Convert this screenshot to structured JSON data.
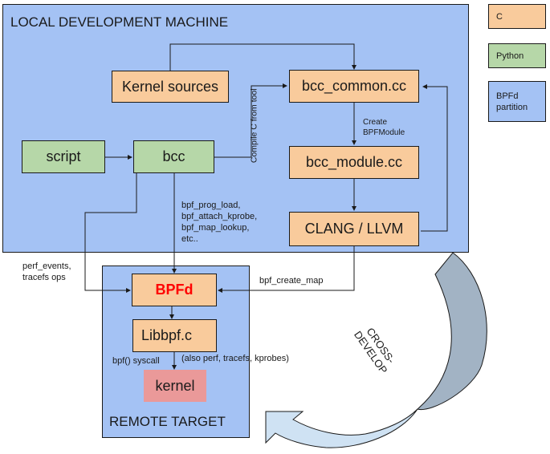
{
  "regions": {
    "local": {
      "title": "LOCAL DEVELOPMENT MACHINE"
    },
    "remote": {
      "title": "REMOTE TARGET"
    }
  },
  "nodes": {
    "kernel_sources": {
      "label": "Kernel sources",
      "language": "C"
    },
    "bcc_common": {
      "label": "bcc_common.cc",
      "language": "C"
    },
    "script": {
      "label": "script",
      "language": "Python"
    },
    "bcc": {
      "label": "bcc",
      "language": "Python"
    },
    "bcc_module": {
      "label": "bcc_module.cc",
      "language": "C"
    },
    "clang_llvm": {
      "label": "CLANG / LLVM",
      "language": "C"
    },
    "bpfd": {
      "label": "BPFd",
      "language": "C",
      "text_color": "#ff0000"
    },
    "libbpf": {
      "label": "Libbpf.c",
      "language": "C"
    },
    "kernel": {
      "label": "kernel"
    }
  },
  "edge_labels": {
    "compile_c": "Compile C from tool",
    "create_module_line1": "Create",
    "create_module_line2": "BPFModule",
    "bpf_calls_line1": "bpf_prog_load,",
    "bpf_calls_line2": "bpf_attach_kprobe,",
    "bpf_calls_line3": "bpf_map_lookup,",
    "bpf_calls_line4": "etc..",
    "perf_line1": "perf_events,",
    "perf_line2": "tracefs ops",
    "create_map": "bpf_create_map",
    "syscall": "bpf() syscall",
    "also": "(also perf, tracefs, kprobes)"
  },
  "cross_develop": {
    "line1": "CROSS-",
    "line2": "DEVELOP"
  },
  "legend": [
    {
      "label": "C",
      "color": "#f9cb9c"
    },
    {
      "label": "Python",
      "color": "#b6d7a8"
    },
    {
      "label": "BPFd partition",
      "line1": "BPFd",
      "line2": "partition",
      "color": "#a4c2f4"
    }
  ],
  "colors": {
    "c_box": "#f9cb9c",
    "python_box": "#b6d7a8",
    "partition": "#a4c2f4",
    "kernel_box": "#ea9999",
    "arrow_top": "#a2b3c4",
    "arrow_bottom": "#cfe2f3"
  }
}
